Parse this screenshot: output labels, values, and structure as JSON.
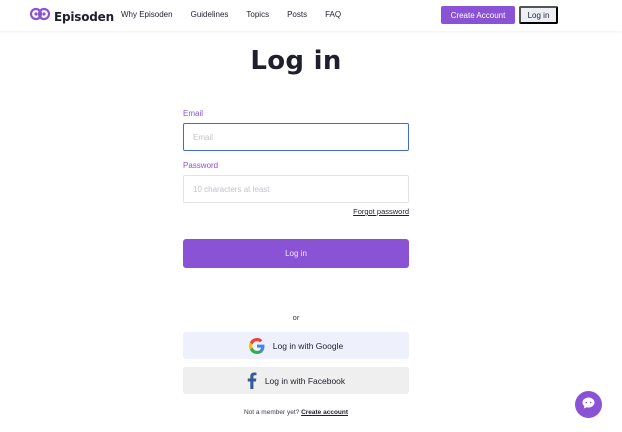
{
  "header": {
    "logo_text": "Episoden",
    "nav": [
      "Why Episoden",
      "Guidelines",
      "Topics",
      "Posts",
      "FAQ"
    ],
    "create_account": "Create Account",
    "login": "Log in"
  },
  "main": {
    "title": "Log in",
    "email_label": "Email",
    "email_placeholder": "Email",
    "password_label": "Password",
    "password_placeholder": "10 characters at least",
    "forgot_password": "Forgot password",
    "submit": "Log in",
    "or": "or",
    "google": "Log in with Google",
    "facebook": "Log in with Facebook",
    "not_member": "Not a member yet?",
    "create_account": "Create account"
  },
  "colors": {
    "accent": "#8a53d6",
    "focus_border": "#3e6fc0"
  },
  "icons": {
    "logo": "episoden-logo-icon",
    "google": "google-icon",
    "facebook": "facebook-icon",
    "chat": "chat-icon"
  }
}
